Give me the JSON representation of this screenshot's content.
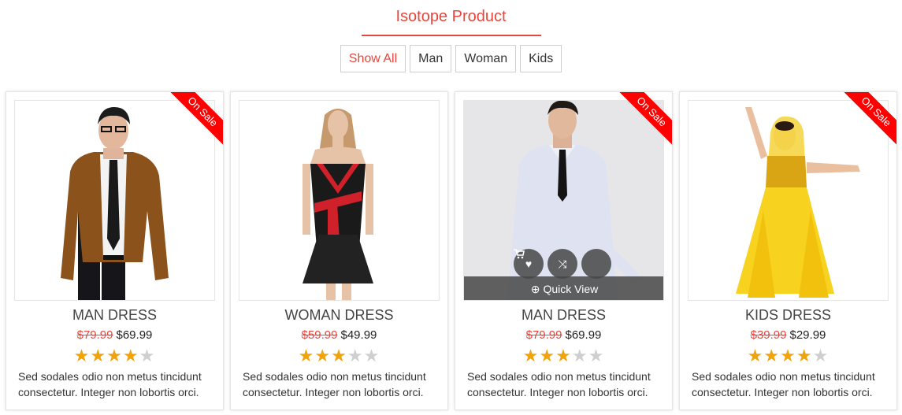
{
  "section": {
    "title": "Isotope Product"
  },
  "filters": [
    {
      "label": "Show All",
      "active": true
    },
    {
      "label": "Man",
      "active": false
    },
    {
      "label": "Woman",
      "active": false
    },
    {
      "label": "Kids",
      "active": false
    }
  ],
  "colors": {
    "accent": "#e8453c",
    "ribbon": "#ff0000",
    "star_on": "#f0a30a",
    "star_off": "#cfcfcf"
  },
  "products": [
    {
      "name": "MAN DRESS",
      "old_price": "$79.99",
      "price": "$69.99",
      "rating": 4,
      "max_rating": 5,
      "badge": "On Sale",
      "description": "Sed sodales odio non metus tincidunt consectetur. Integer non lobortis orci.",
      "image_icon": "man-in-brown-blazer-photo"
    },
    {
      "name": "WOMAN DRESS",
      "old_price": "$59.99",
      "price": "$49.99",
      "rating": 3,
      "max_rating": 5,
      "badge": "",
      "description": "Sed sodales odio non metus tincidunt consectetur. Integer non lobortis orci.",
      "image_icon": "mannequin-black-red-dress-photo"
    },
    {
      "name": "MAN DRESS",
      "old_price": "$79.99",
      "price": "$69.99",
      "rating": 3,
      "max_rating": 5,
      "badge": "On Sale",
      "description": "Sed sodales odio non metus tincidunt consectetur. Integer non lobortis orci.",
      "image_icon": "man-in-white-shirt-photo",
      "hover": {
        "quick_view_label": "Quick View",
        "icons": [
          "heart-icon",
          "shuffle-icon",
          "cart-icon"
        ]
      }
    },
    {
      "name": "KIDS DRESS",
      "old_price": "$39.99",
      "price": "$29.99",
      "rating": 4,
      "max_rating": 5,
      "badge": "On Sale",
      "description": "Sed sodales odio non metus tincidunt consectetur. Integer non lobortis orci.",
      "image_icon": "girl-in-yellow-dance-costume-photo"
    }
  ]
}
